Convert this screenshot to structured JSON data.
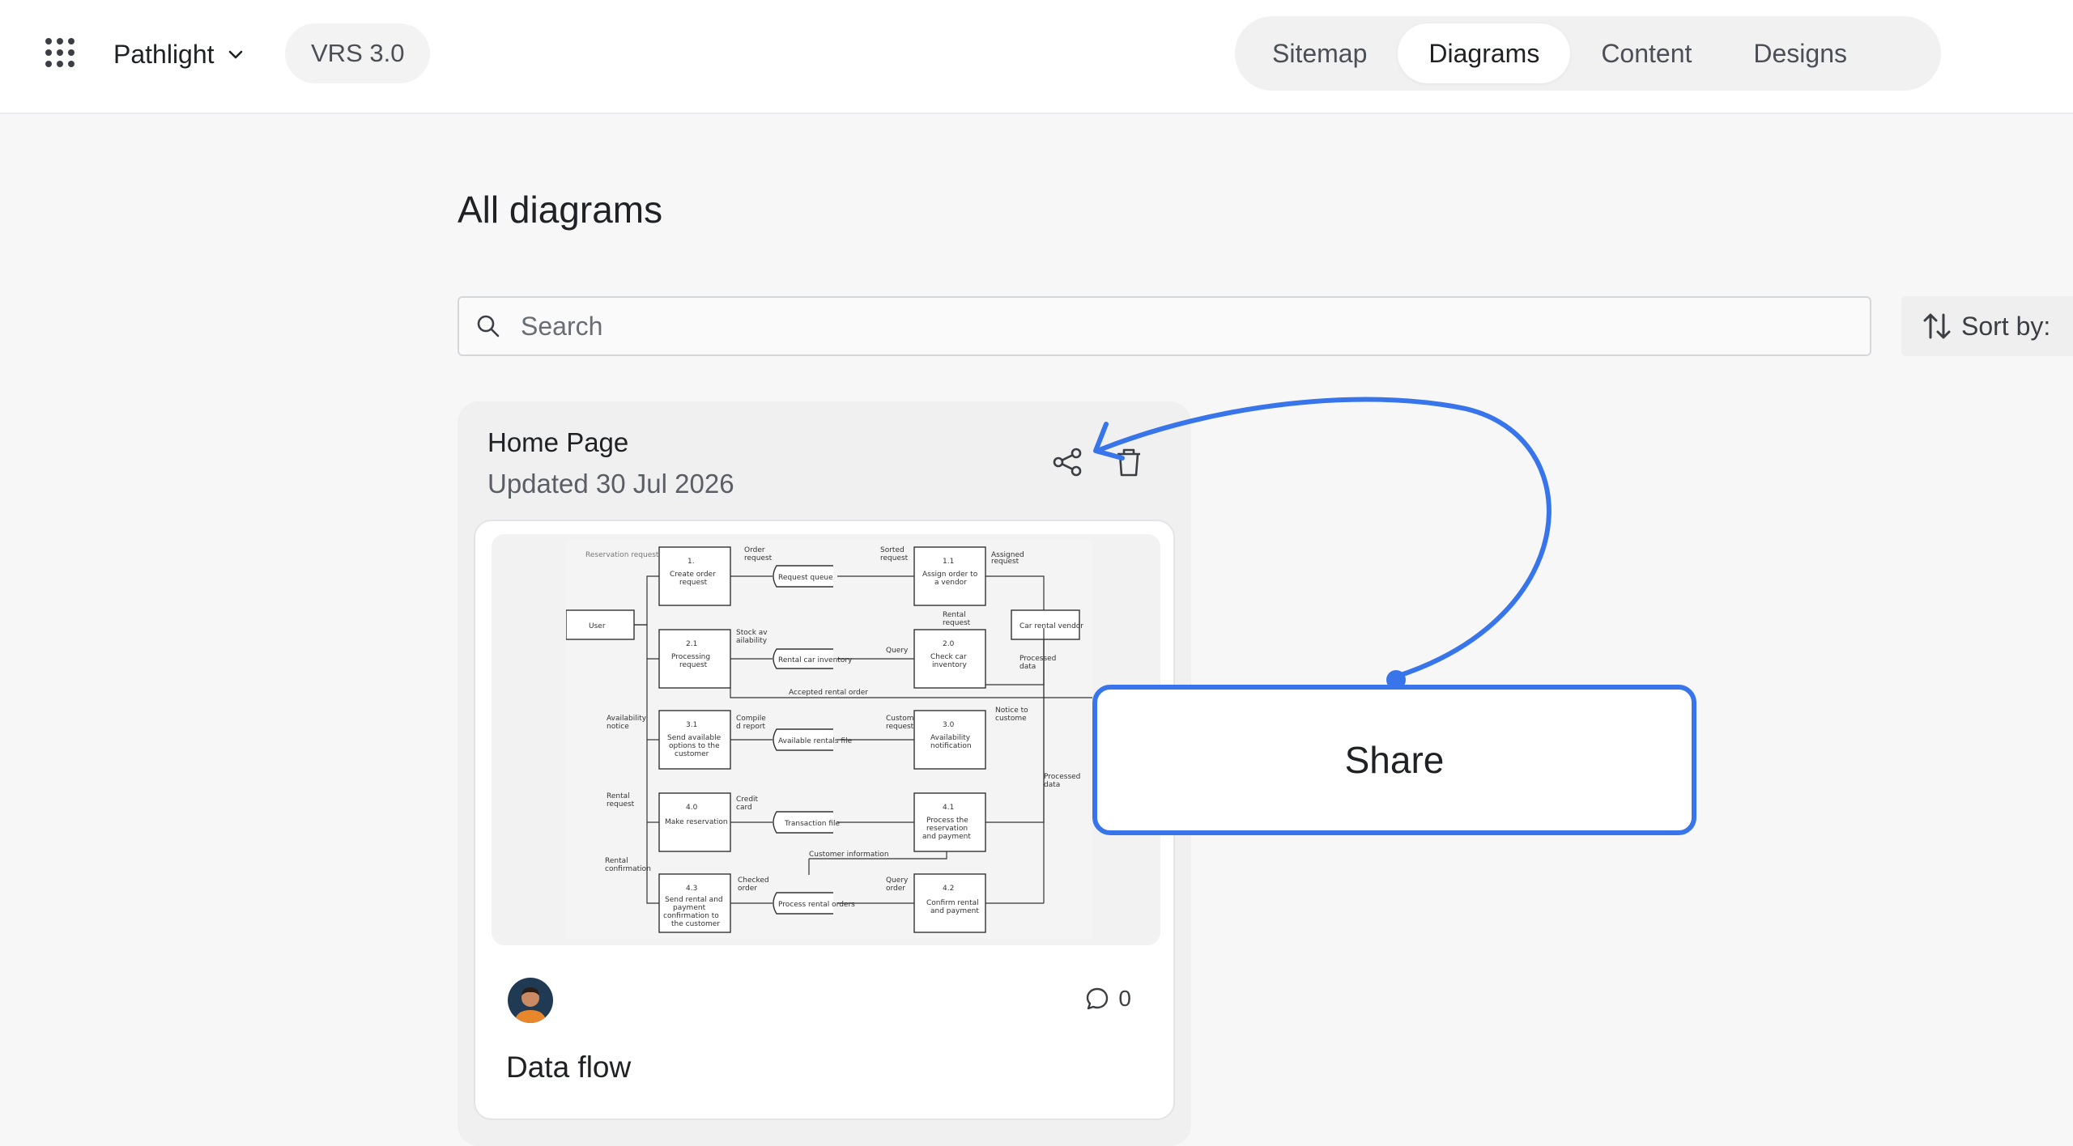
{
  "header": {
    "project_name": "Pathlight",
    "version": "VRS 3.0",
    "tabs": [
      {
        "label": "Sitemap",
        "active": false
      },
      {
        "label": "Diagrams",
        "active": true
      },
      {
        "label": "Content",
        "active": false
      },
      {
        "label": "Designs",
        "active": false
      }
    ]
  },
  "main": {
    "title": "All diagrams",
    "search": {
      "placeholder": "Search",
      "value": ""
    },
    "sort_label": "Sort by: ",
    "cards": [
      {
        "page": "Home Page",
        "updated": "Updated 30 Jul 2026",
        "name": "Data flow",
        "comment_count": "0"
      }
    ]
  },
  "callout": {
    "label": "Share"
  },
  "colors": {
    "accent": "#3874ea",
    "background": "#f7f7f8"
  },
  "icons": [
    "apps-grid-icon",
    "chevron-down-icon",
    "search-icon",
    "sort-icon",
    "share-icon",
    "trash-icon",
    "comment-icon"
  ]
}
